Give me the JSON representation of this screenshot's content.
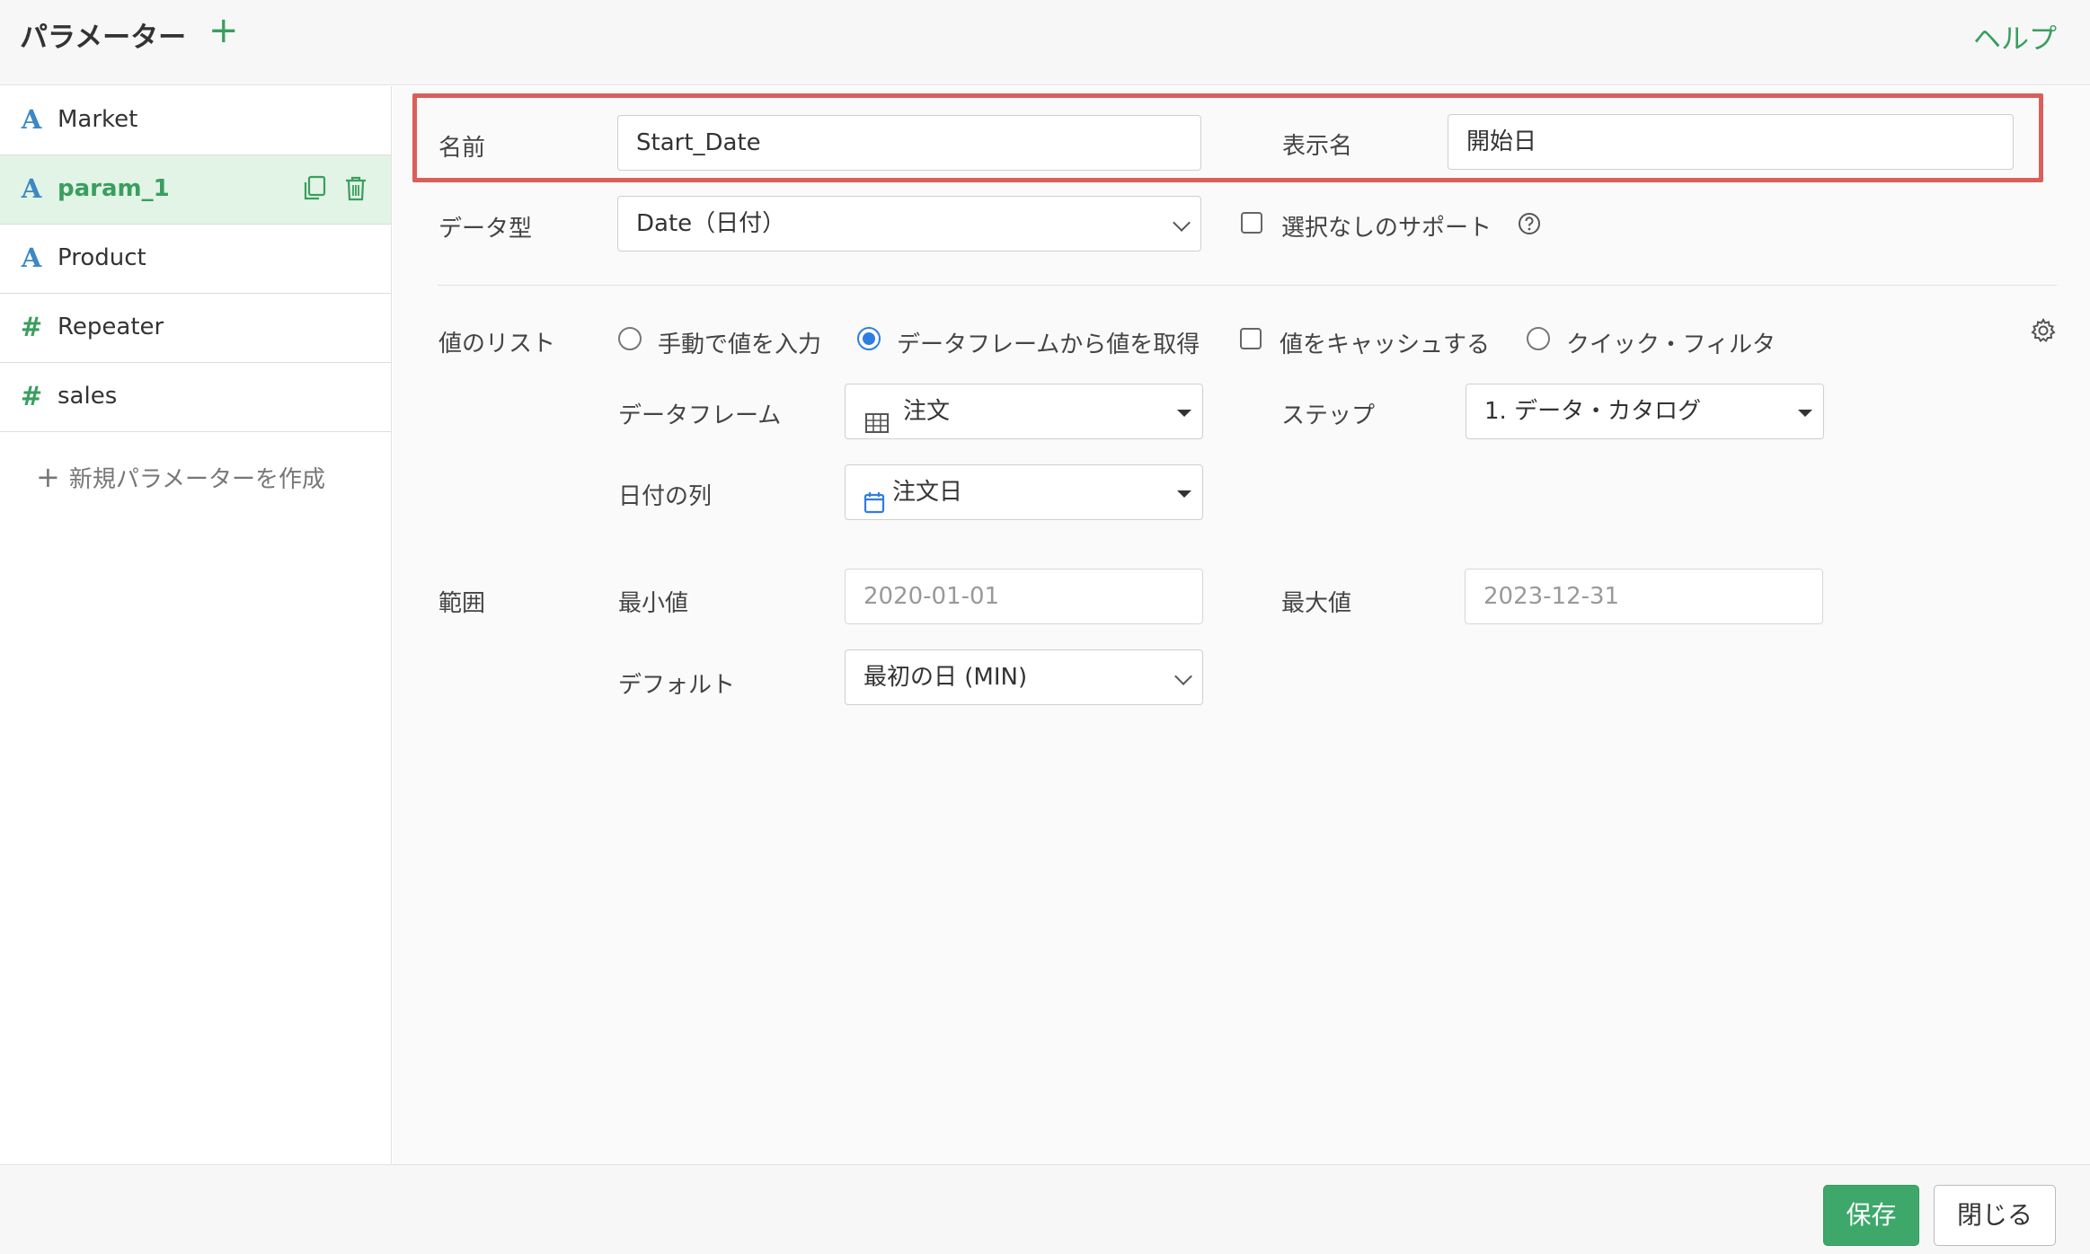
{
  "header": {
    "title": "パラメーター",
    "add_icon": "plus-icon",
    "help": "ヘルプ"
  },
  "sidebar": {
    "items": [
      {
        "icon": "A",
        "label": "Market"
      },
      {
        "icon": "A",
        "label": "param_1"
      },
      {
        "icon": "A",
        "label": "Product"
      },
      {
        "icon": "#",
        "label": "Repeater"
      },
      {
        "icon": "#",
        "label": "sales"
      }
    ],
    "new_param": "新規パラメーターを作成",
    "active_actions": [
      "copy-icon",
      "trash-icon"
    ]
  },
  "form": {
    "name_label": "名前",
    "name_value": "Start_Date",
    "display_name_label": "表示名",
    "display_name_value": "開始日",
    "datatype_label": "データ型",
    "datatype_value": "Date（日付）",
    "support_none_label": "選択なしのサポート",
    "value_list_label": "値のリスト",
    "value_list_options": {
      "manual": "手動で値を入力",
      "from_dataframe": "データフレームから値を取得",
      "cache": "値をキャッシュする",
      "quick_filter": "クイック・フィルタ"
    },
    "dataframe_label": "データフレーム",
    "dataframe_value": "注文",
    "step_label": "ステップ",
    "step_value": "1. データ・カタログ",
    "date_column_label": "日付の列",
    "date_column_value": "注文日",
    "range_label": "範囲",
    "min_label": "最小値",
    "min_value": "2020-01-01",
    "max_label": "最大値",
    "max_value": "2023-12-31",
    "default_label": "デフォルト",
    "default_value": "最初の日 (MIN)"
  },
  "footer": {
    "save": "保存",
    "close": "閉じる"
  },
  "colors": {
    "accent": "#3a9e5f",
    "highlight": "#d9605a",
    "radio": "#2f7de1"
  }
}
